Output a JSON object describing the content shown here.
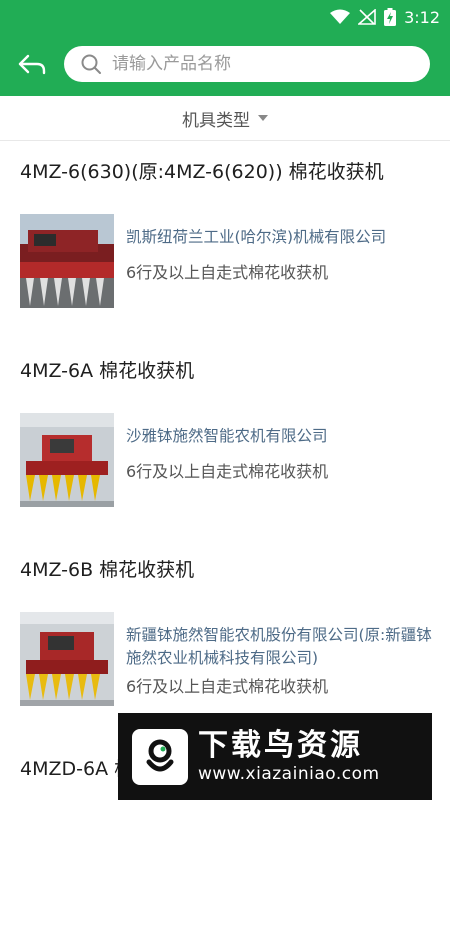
{
  "status": {
    "time": "3:12"
  },
  "search": {
    "placeholder": "请输入产品名称"
  },
  "filter": {
    "label": "机具类型"
  },
  "products": [
    {
      "title": "4MZ-6(630)(原:4MZ-6(620)) 棉花收获机",
      "company": "凯斯纽荷兰工业(哈尔滨)机械有限公司",
      "type": "6行及以上自走式棉花收获机"
    },
    {
      "title": "4MZ-6A 棉花收获机",
      "company": "沙雅钵施然智能农机有限公司",
      "type": "6行及以上自走式棉花收获机"
    },
    {
      "title": "4MZ-6B 棉花收获机",
      "company": "新疆钵施然智能农机股份有限公司(原:新疆钵施然农业机械科技有限公司)",
      "type": "6行及以上自走式棉花收获机"
    },
    {
      "title": "4MZD-6A 棉花收获机",
      "company": "",
      "type": ""
    }
  ],
  "watermark": {
    "title": "下载鸟资源",
    "url": "www.xiazainiao.com"
  },
  "colors": {
    "brand_green": "#21ad55",
    "company_text": "#4e6b87"
  }
}
